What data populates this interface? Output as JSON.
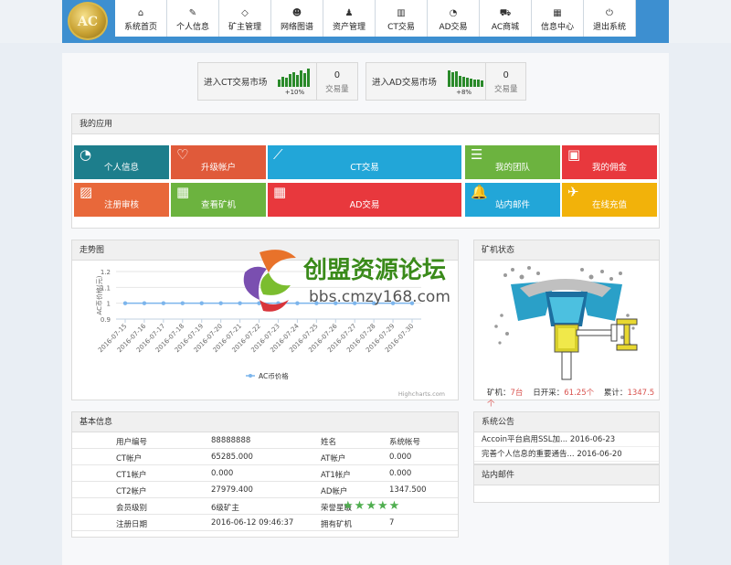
{
  "logo": {
    "text": "AC"
  },
  "nav": [
    {
      "icon": "home-icon",
      "glyph": "⌂",
      "label": "系统首页"
    },
    {
      "icon": "edit-icon",
      "glyph": "✎",
      "label": "个人信息"
    },
    {
      "icon": "diamond-icon",
      "glyph": "◇",
      "label": "矿主管理"
    },
    {
      "icon": "users-icon",
      "glyph": "☻",
      "label": "网络图谱"
    },
    {
      "icon": "user-icon",
      "glyph": "♟",
      "label": "资产管理"
    },
    {
      "icon": "bar-chart-icon",
      "glyph": "▥",
      "label": "CT交易"
    },
    {
      "icon": "dashboard-icon",
      "glyph": "◔",
      "label": "AD交易"
    },
    {
      "icon": "cart-icon",
      "glyph": "⛟",
      "label": "AC商城"
    },
    {
      "icon": "calendar-icon",
      "glyph": "▦",
      "label": "信息中心"
    },
    {
      "icon": "power-icon",
      "glyph": "⏻",
      "label": "退出系统"
    }
  ],
  "markets": [
    {
      "label": "进入CT交易市场",
      "pct": "+10%",
      "value": "0",
      "caption": "交易量",
      "bars": [
        0.4,
        0.55,
        0.5,
        0.7,
        0.8,
        0.65,
        0.9,
        0.75,
        1.0
      ]
    },
    {
      "label": "进入AD交易市场",
      "pct": "+8%",
      "value": "0",
      "caption": "交易量",
      "bars": [
        0.9,
        0.8,
        0.85,
        0.6,
        0.55,
        0.5,
        0.45,
        0.4,
        0.4,
        0.35
      ]
    }
  ],
  "apps": {
    "title": "我的应用",
    "tiles": [
      {
        "label": "个人信息",
        "icon": "dashboard-icon",
        "glyph": "◔",
        "color": "#1d7e8c"
      },
      {
        "label": "升级帐户",
        "icon": "heart-icon",
        "glyph": "♡",
        "color": "#e05a3a"
      },
      {
        "label": "CT交易",
        "icon": "line-chart-icon",
        "glyph": "⟋",
        "color": "#22a6d8"
      },
      {
        "label": "我的团队",
        "icon": "list-icon",
        "glyph": "☰",
        "color": "#6cb33f"
      },
      {
        "label": "我的佣金",
        "icon": "briefcase-icon",
        "glyph": "▣",
        "color": "#e8383d"
      },
      {
        "label": "注册审核",
        "icon": "picture-icon",
        "glyph": "▨",
        "color": "#e8683a"
      },
      {
        "label": "查看矿机",
        "icon": "calendar-icon",
        "glyph": "▦",
        "color": "#6cb33f"
      },
      {
        "label": "AD交易",
        "icon": "table-icon",
        "glyph": "▦",
        "color": "#e8383d"
      },
      {
        "label": "站内邮件",
        "icon": "bell-icon",
        "glyph": "🔔",
        "color": "#22a6d8"
      },
      {
        "label": "在线充值",
        "icon": "plane-icon",
        "glyph": "✈",
        "color": "#f2b20a"
      }
    ]
  },
  "trend": {
    "title": "走势图",
    "credit": "Highcharts.com"
  },
  "chart_data": {
    "type": "line",
    "ylabel": "AC币价格(元)",
    "ylim": [
      0.9,
      1.2
    ],
    "yticks": [
      "0.9",
      "1",
      "1.1",
      "1.2"
    ],
    "categories": [
      "2016-07-15",
      "2016-07-16",
      "2016-07-17",
      "2016-07-18",
      "2016-07-19",
      "2016-07-20",
      "2016-07-21",
      "2016-07-22",
      "2016-07-23",
      "2016-07-24",
      "2016-07-25",
      "2016-07-26",
      "2016-07-27",
      "2016-07-28",
      "2016-07-29",
      "2016-07-30"
    ],
    "series": [
      {
        "name": "AC币价格",
        "values": [
          1,
          1,
          1,
          1,
          1,
          1,
          1,
          1,
          1,
          1,
          1,
          1,
          1,
          1,
          1,
          1
        ],
        "color": "#7cb5ec"
      }
    ],
    "legend": "bottom-center"
  },
  "machine": {
    "title": "矿机状态",
    "count_label": "矿机：",
    "count": "7台",
    "daily_label": "日开采：",
    "daily": "61.25个",
    "total_label": "累计：",
    "total": "1347.5个"
  },
  "basic": {
    "title": "基本信息",
    "rows": [
      {
        "k1": "用户编号",
        "v1": "88888888",
        "k2": "姓名",
        "v2": "系统帐号"
      },
      {
        "k1": "CT帐户",
        "v1": "65285.000",
        "k2": "AT帐户",
        "v2": "0.000"
      },
      {
        "k1": "CT1帐户",
        "v1": "0.000",
        "k2": "AT1帐户",
        "v2": "0.000"
      },
      {
        "k1": "CT2帐户",
        "v1": "27979.400",
        "k2": "AD帐户",
        "v2": "1347.500"
      },
      {
        "k1": "会员级别",
        "v1": "6级矿主",
        "k2": "荣誉星级",
        "v2": ""
      },
      {
        "k1": "注册日期",
        "v1": "2016-06-12 09:46:37",
        "k2": "拥有矿机",
        "v2": "7"
      }
    ],
    "stars": 5
  },
  "notice": {
    "title": "系统公告",
    "items": [
      {
        "text": "Accoin平台启用SSL加...",
        "date": "2016-06-23"
      },
      {
        "text": "完善个人信息的重要通告...",
        "date": "2016-06-20"
      }
    ]
  },
  "mail": {
    "title": "站内邮件"
  },
  "watermark": {
    "title": "创盟资源论坛",
    "url": "bbs.cmzy168.com"
  }
}
